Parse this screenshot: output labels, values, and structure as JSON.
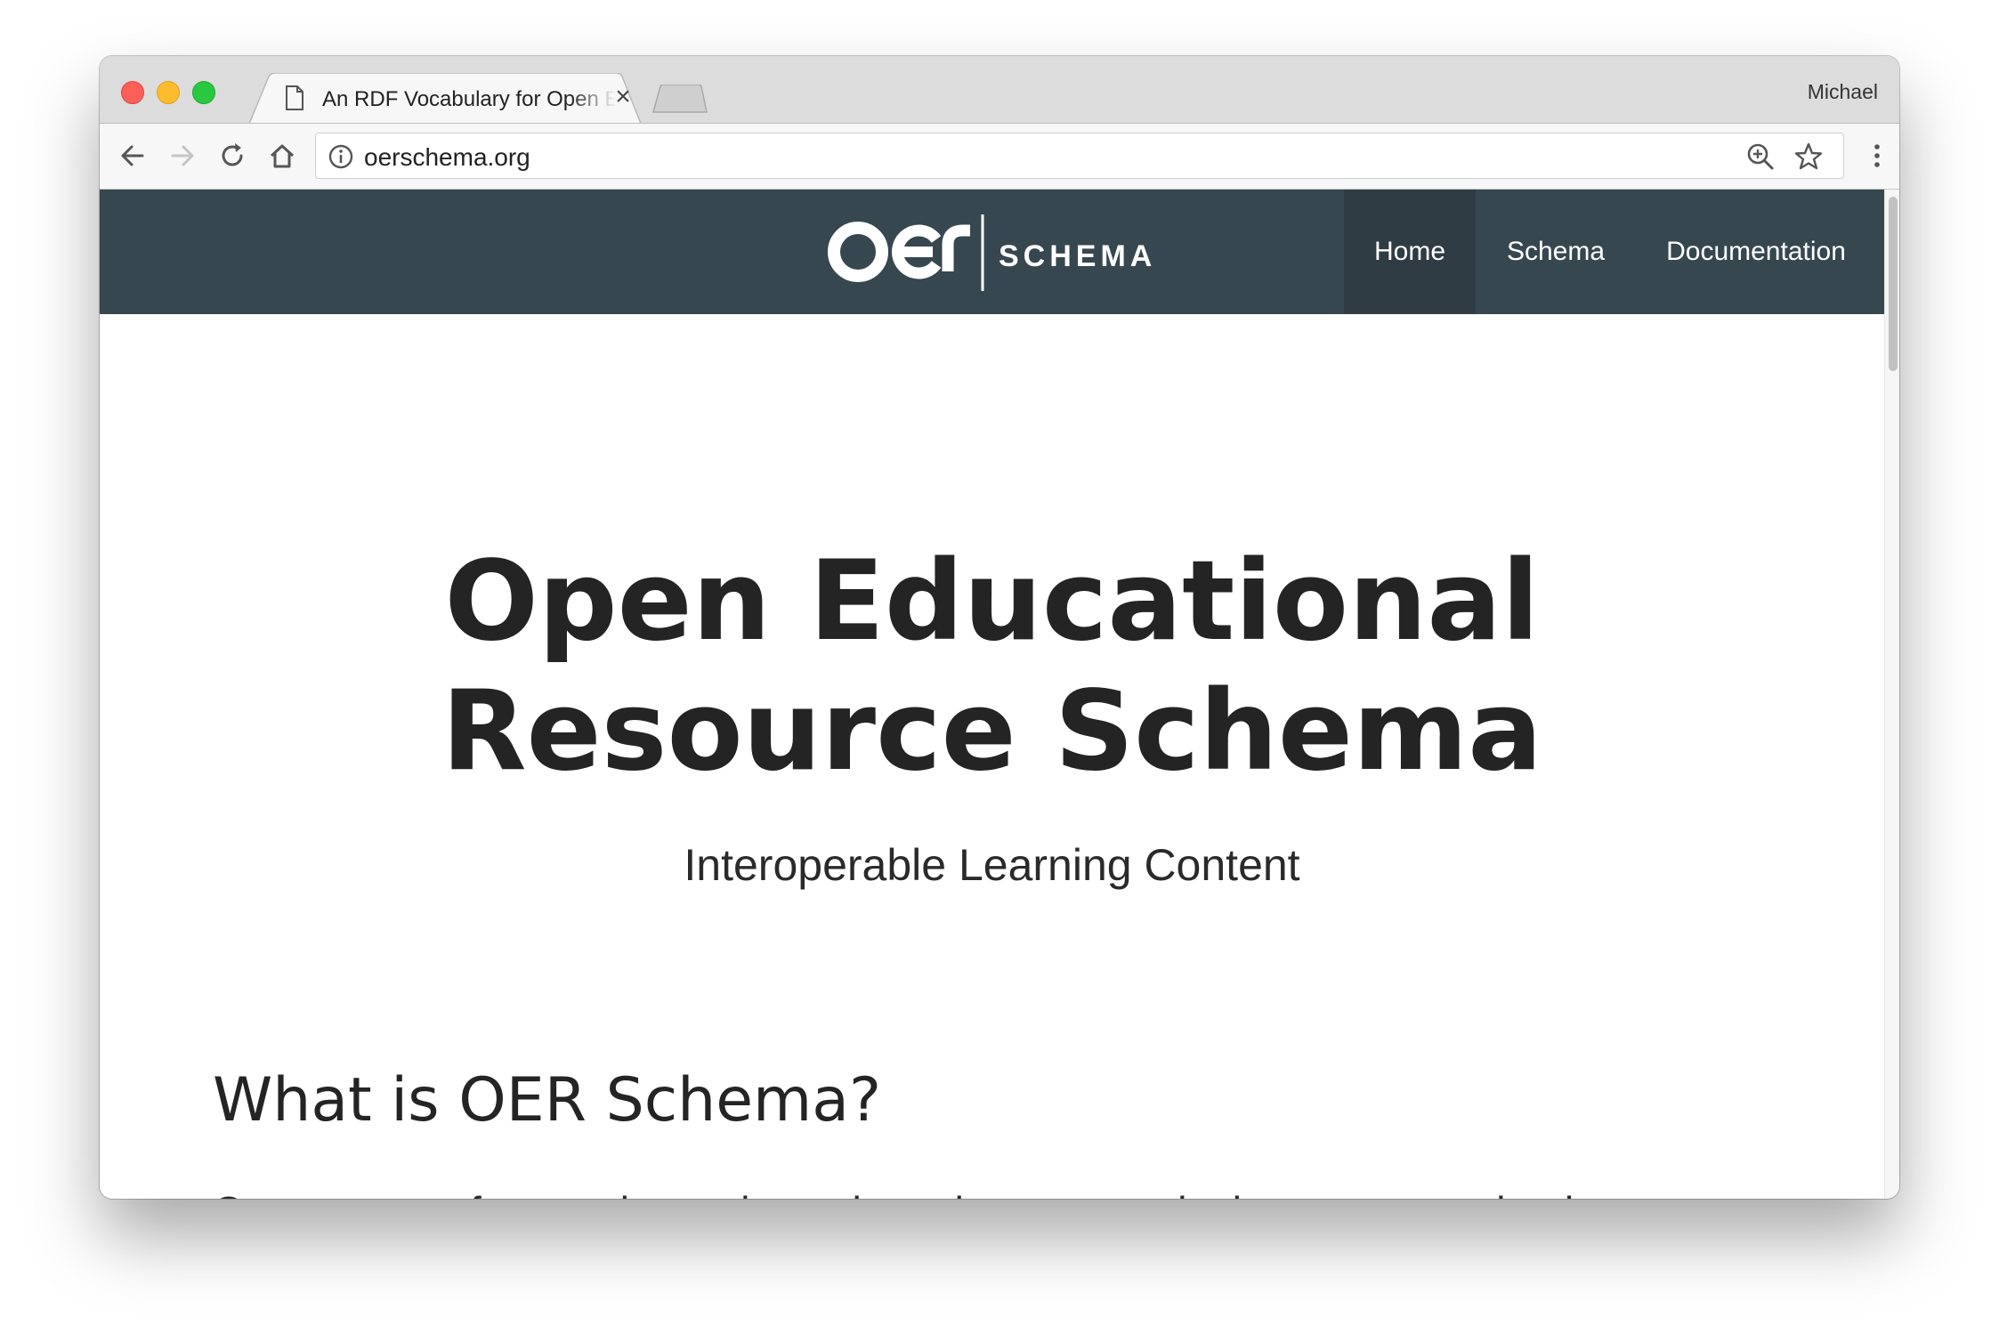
{
  "browser": {
    "tab_title": "An RDF Vocabulary for Open Educational Resources",
    "profile_name": "Michael",
    "url": "oerschema.org",
    "icons": {
      "back": "back-arrow-icon",
      "forward": "forward-arrow-icon",
      "reload": "reload-icon",
      "home": "home-icon",
      "site_info": "info-icon",
      "zoom": "zoom-in-icon",
      "bookmark": "star-icon",
      "menu": "kebab-menu-icon"
    }
  },
  "site": {
    "logo": {
      "mark": "OER",
      "wordmark": "SCHEMA"
    },
    "nav": [
      {
        "label": "Home",
        "active": true
      },
      {
        "label": "Schema",
        "active": false
      },
      {
        "label": "Documentation",
        "active": false
      }
    ],
    "colors": {
      "nav_bg": "#37474f",
      "nav_active_bg": "#2f3c43",
      "text": "#242424"
    },
    "hero": {
      "title_line1": "Open Educational",
      "title_line2": "Resource Schema",
      "subtitle": "Interoperable Learning Content"
    },
    "section": {
      "title": "What is OER Schema?",
      "body": "Open content frequently results and requires content in the same way that has"
    }
  }
}
